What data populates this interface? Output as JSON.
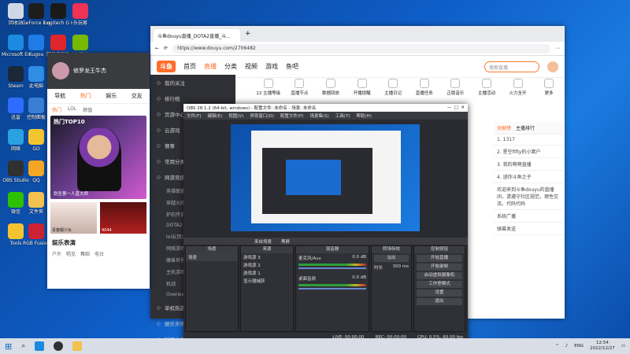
{
  "desktop": {
    "icons": [
      {
        "label": "回收站",
        "color": "#d0d8e8"
      },
      {
        "label": "GeForce Experience",
        "color": "#1d1d1d"
      },
      {
        "label": "Logitech G HUB",
        "color": "#1a1a1a"
      },
      {
        "label": "乐玩客",
        "color": "#e35"
      },
      {
        "label": "Microsoft Edge",
        "color": "#1b8ae0"
      },
      {
        "label": "Kugou",
        "color": "#1f7be6"
      },
      {
        "label": "网易云音乐",
        "color": "#e0262b"
      },
      {
        "label": "NVIDIA",
        "color": "#76b900"
      },
      {
        "label": "Steam",
        "color": "#1b2838"
      },
      {
        "label": "此电脑",
        "color": "#2f8de4"
      },
      {
        "label": "迅雷",
        "color": "#2d6cff"
      },
      {
        "label": "控制面板",
        "color": "#3a7fd5"
      },
      {
        "label": "网络",
        "color": "#2aa1e0"
      },
      {
        "label": "GO",
        "color": "#f4c430"
      },
      {
        "label": "OBS Studio",
        "color": "#303030"
      },
      {
        "label": "QQ",
        "color": "#f5a623"
      },
      {
        "label": "微信",
        "color": "#2dc100"
      },
      {
        "label": "文件夹",
        "color": "#f2c14e"
      },
      {
        "label": "Tools",
        "color": "#f4c430"
      },
      {
        "label": "RGB Fusion",
        "color": "#c23"
      }
    ]
  },
  "browser": {
    "tab_title": "斗鱼douyu直播_DOTA2直播_斗...",
    "url": "https://www.douyu.com/2706482",
    "nav_items": [
      "首页",
      "直播",
      "分类",
      "视频",
      "游戏",
      "鱼吧"
    ],
    "search_placeholder": "搜索直播",
    "logo": "斗鱼",
    "tools": [
      "12 主播等级",
      "直播节点",
      "数据回放",
      "开播提醒",
      "主播日记",
      "直播任务",
      "正版音乐",
      "主播活动",
      "火力全开",
      "更多"
    ],
    "sidebar": {
      "items": [
        "我的关注",
        "排行榜",
        "页游中心",
        "云游戏",
        "赛事",
        "常用分类",
        "网游竞技",
        "单机热游",
        "娱乐天地",
        "科技文化"
      ],
      "sub": [
        "英雄联盟",
        "穿越火线",
        "炉石传说",
        "DOTA2",
        "lol云顶之弈",
        "网络游戏",
        "魔兽世界",
        "主机游戏",
        "机战",
        "Overwatch"
      ]
    },
    "chat": {
      "tabs": [
        "贡献榜",
        "主播排行"
      ],
      "rows": [
        "1. 1317",
        "2. 星空fifty的小窝户",
        "3. 我的萌萌直播",
        "4. 迷你斗鱼之子",
        "欢迎来到斗鱼douyu的直播间，请遵守社区规范，理性交流。代码代码",
        "系统广播",
        "弹幕发送"
      ]
    }
  },
  "leftapp": {
    "user": "修罗龙王牛杰",
    "tabs": [
      "导航",
      "热门",
      "娱乐",
      "交友"
    ],
    "subtabs": [
      "热门",
      "LOL",
      "颜值"
    ],
    "banner_title": "热门TOP10",
    "items": [
      "剑圣第一人直大师",
      "青春靓少女",
      "4044"
    ],
    "section": "娱乐表演",
    "section_tabs": [
      "户外",
      "唱见",
      "舞蹈",
      "电台"
    ]
  },
  "obs": {
    "title": "OBS 28.1.2 (64-bit, windows) - 配置文件: 未命名 - 场景: 未命名",
    "menu": [
      "文件(F)",
      "编辑(E)",
      "视图(V)",
      "停靠窗口(D)",
      "配置文件(P)",
      "场景集(S)",
      "工具(T)",
      "帮助(H)"
    ],
    "toolbar": [
      "来自场景",
      "黑屏"
    ],
    "docks": {
      "scenes": {
        "title": "场景",
        "items": [
          "场景"
        ]
      },
      "sources": {
        "title": "来源",
        "items": [
          "游戏源 3",
          "游戏源 2",
          "游戏源 1",
          "显示器捕获"
        ]
      },
      "mixer": {
        "title": "混音器",
        "items": [
          "麦克风/Aux",
          "桌面音频"
        ],
        "values": [
          "0.0 dB",
          "0.0 dB"
        ]
      },
      "transitions": {
        "title": "转场特效",
        "items": [
          "淡出",
          "时长",
          "300 ms"
        ]
      },
      "controls": {
        "title": "控制按钮",
        "items": [
          "开始直播",
          "开始录制",
          "启动虚拟摄像机",
          "工作室模式",
          "设置",
          "退出"
        ]
      }
    },
    "status": [
      "LIVE: 00:00:00",
      "REC: 00:00:00",
      "CPU: 0.5%, 60.00 fps"
    ]
  },
  "taskbar": {
    "lang": "ENG",
    "time": "12:54",
    "date": "2022/12/27"
  }
}
